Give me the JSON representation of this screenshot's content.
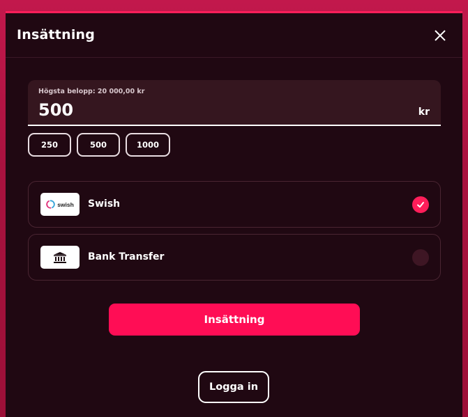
{
  "modal": {
    "title": "Insättning"
  },
  "amount": {
    "label": "Högsta belopp: 20 000,00 kr",
    "value": "500",
    "unit": "kr"
  },
  "quick_amounts": [
    "250",
    "500",
    "1000"
  ],
  "payment_methods": [
    {
      "label": "Swish",
      "logo_text": "swish",
      "icon": "swish-logo",
      "selected": true
    },
    {
      "label": "Bank Transfer",
      "icon": "bank-icon",
      "selected": false
    }
  ],
  "actions": {
    "deposit_label": "Insättning",
    "login_label": "Logga in"
  },
  "colors": {
    "accent": "#ff0d55",
    "modal_bg": "#200812",
    "page_bg": "#c2184c"
  }
}
